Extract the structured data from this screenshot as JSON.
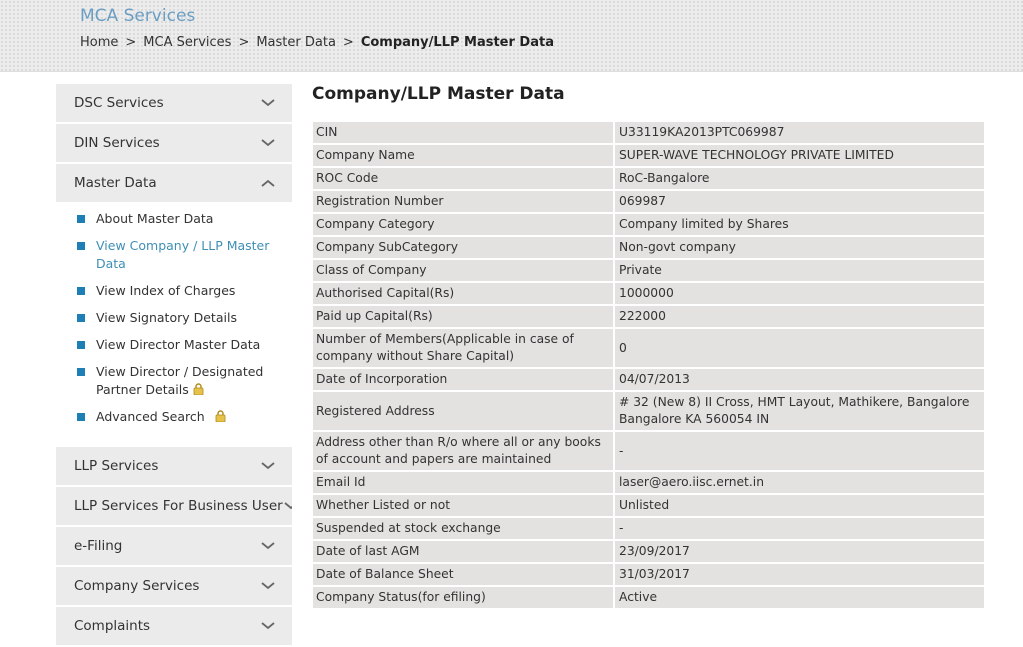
{
  "header": {
    "site_title": "MCA Services",
    "breadcrumb": [
      "Home",
      "MCA Services",
      "Master Data",
      "Company/LLP Master Data"
    ],
    "separator": ">"
  },
  "sidebar": {
    "menus": [
      {
        "label": "DSC Services",
        "expanded": false
      },
      {
        "label": "DIN Services",
        "expanded": false
      },
      {
        "label": "Master Data",
        "expanded": true
      },
      {
        "label": "LLP Services",
        "expanded": false
      },
      {
        "label": "LLP Services For Business User",
        "expanded": false
      },
      {
        "label": "e-Filing",
        "expanded": false
      },
      {
        "label": "Company Services",
        "expanded": false
      },
      {
        "label": "Complaints",
        "expanded": false
      }
    ],
    "master_data_items": [
      {
        "label": "About Master Data",
        "active": false,
        "locked": false
      },
      {
        "label": "View Company / LLP Master Data",
        "active": true,
        "locked": false
      },
      {
        "label": "View Index of Charges",
        "active": false,
        "locked": false
      },
      {
        "label": "View Signatory Details",
        "active": false,
        "locked": false
      },
      {
        "label": "View Director Master Data",
        "active": false,
        "locked": false
      },
      {
        "label": "View Director / Designated Partner Details",
        "active": false,
        "locked": true
      },
      {
        "label": "Advanced Search",
        "active": false,
        "locked": true
      }
    ],
    "icons": {
      "collapsed": "chevron-down-icon",
      "expanded": "chevron-up-icon",
      "bullet": "square-bullet-icon",
      "lock": "lock-icon"
    },
    "bullet_color": "#1d7fb5"
  },
  "main": {
    "title": "Company/LLP Master Data",
    "rows": [
      {
        "label": "CIN",
        "value": "U33119KA2013PTC069987"
      },
      {
        "label": "Company Name",
        "value": "SUPER-WAVE TECHNOLOGY PRIVATE LIMITED"
      },
      {
        "label": "ROC Code",
        "value": "RoC-Bangalore"
      },
      {
        "label": "Registration Number",
        "value": "069987"
      },
      {
        "label": "Company Category",
        "value": "Company limited by Shares"
      },
      {
        "label": "Company SubCategory",
        "value": "Non-govt company"
      },
      {
        "label": "Class of Company",
        "value": "Private"
      },
      {
        "label": "Authorised Capital(Rs)",
        "value": "1000000"
      },
      {
        "label": "Paid up Capital(Rs)",
        "value": "222000"
      },
      {
        "label": "Number of Members(Applicable in case of company without Share Capital)",
        "value": "0"
      },
      {
        "label": "Date of Incorporation",
        "value": "04/07/2013"
      },
      {
        "label": "Registered Address",
        "value": "# 32 (New 8) II Cross, HMT Layout, Mathikere, Bangalore Bangalore KA 560054 IN"
      },
      {
        "label": "Address other than R/o where all or any books of account and papers are maintained",
        "value": "-"
      },
      {
        "label": "Email Id",
        "value": "laser@aero.iisc.ernet.in"
      },
      {
        "label": "Whether Listed or not",
        "value": "Unlisted"
      },
      {
        "label": "Suspended at stock exchange",
        "value": "-"
      },
      {
        "label": "Date of last AGM",
        "value": "23/09/2017"
      },
      {
        "label": "Date of Balance Sheet",
        "value": "31/03/2017"
      },
      {
        "label": "Company Status(for efiling)",
        "value": "Active"
      }
    ]
  },
  "colors": {
    "accent": "#6b9ec3",
    "active_link": "#3f8fb4",
    "row_bg": "#e4e2e0",
    "menu_bg": "#ebebeb"
  }
}
